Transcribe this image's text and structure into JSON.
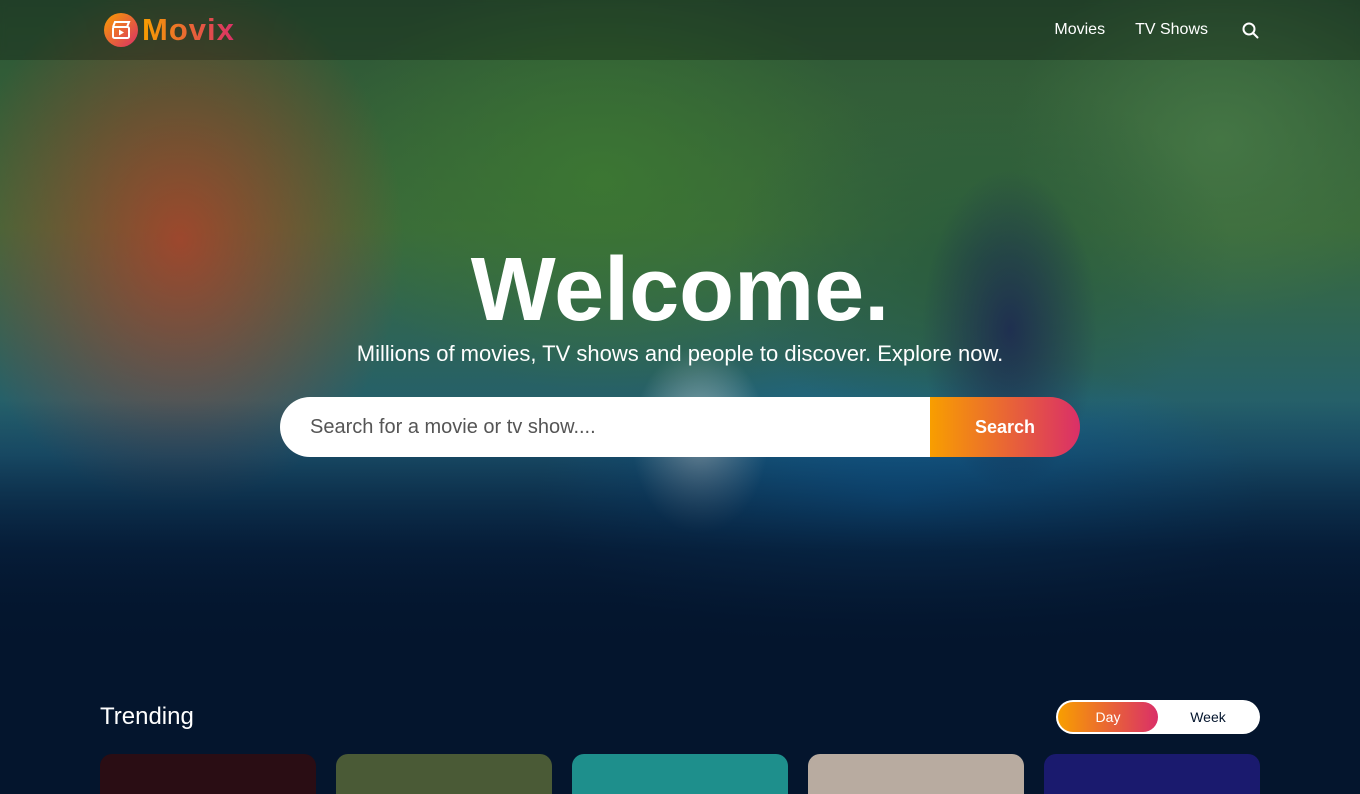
{
  "header": {
    "logo_text": "Movix",
    "nav": {
      "movies": "Movies",
      "tv_shows": "TV Shows"
    }
  },
  "hero": {
    "title": "Welcome.",
    "subtitle": "Millions of movies, TV shows and people to discover. Explore now.",
    "search": {
      "placeholder": "Search for a movie or tv show....",
      "button_label": "Search"
    }
  },
  "trending": {
    "title": "Trending",
    "tabs": [
      {
        "label": "Day",
        "active": true
      },
      {
        "label": "Week",
        "active": false
      }
    ],
    "card_colors": [
      "#2a0d14",
      "#4a5a36",
      "#1e8f8c",
      "#b8aba0",
      "#1a1a6e"
    ]
  },
  "colors": {
    "background": "#04152d",
    "accent_start": "#f89e00",
    "accent_end": "#da2f68"
  }
}
